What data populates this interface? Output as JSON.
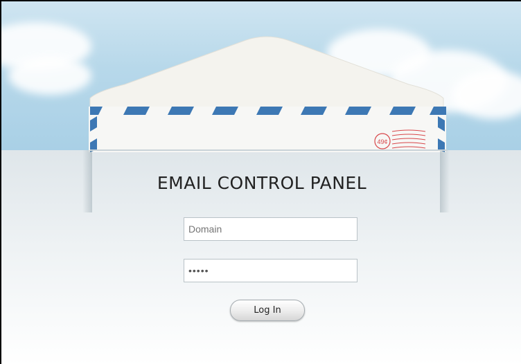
{
  "panel": {
    "title": "EMAIL CONTROL PANEL"
  },
  "form": {
    "domain_placeholder": "Domain",
    "domain_value": "",
    "password_value": "•••••",
    "login_label": "Log In"
  },
  "stamp": {
    "text": "49¢"
  },
  "colors": {
    "sky": "#b7d8ea",
    "stripe_blue": "#3d78b4",
    "stamp_red": "#d8474a"
  }
}
